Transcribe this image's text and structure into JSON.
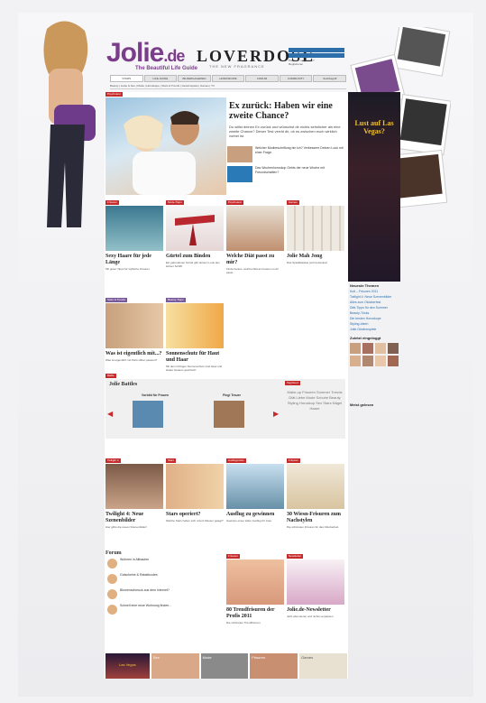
{
  "brand": {
    "name": "Jolie",
    "tld": ".de",
    "tagline": "The Beautiful Life Guide",
    "partner": "LOVERDOSE",
    "partner_sub": "THE NEW FRAGRANCE"
  },
  "header": {
    "login_labels": [
      "Passwort vergessen?",
      "Registrieren"
    ],
    "nav": [
      "STARS",
      "LIFE GUIDE",
      "BILDERGALERIEN",
      "HOROSKOPE",
      "FORUM",
      "COMMUNITY",
      "Suchbegriff"
    ],
    "subnav": "Beauty | Liebe & Sex | Mode | Horoskope | Stars & Trends | Gewinnspiele | Games | TV"
  },
  "hero": {
    "tag": "Psychotest",
    "title": "Ex zurück: Haben wir eine zweite Chance?",
    "text": "Du willst deinen Ex zurück und wünschst dir nichts sehnlicher als eine zweite Chance? Dieser Test verrät dir, ob es zwischen euch wirklich vorbei ist.",
    "subs": [
      {
        "text": "Welcher Modbeschriftung bin ich? Verbessere Deinen Look mit einer Frage."
      },
      {
        "text": "Das Wochenhoroskop Gehts der neue Woche mit Freundschaften?"
      }
    ]
  },
  "cards_row1": [
    {
      "tag": "Frisuren",
      "title": "Sexy Haare für jede Länge",
      "text": "Mit guten Tipps für stylische Frisuren."
    },
    {
      "tag": "Mode-Tipps",
      "title": "Gürtel zum Binden",
      "text": "Ein gebundener Gürtel gibt deinem Look den letzten Schliff."
    },
    {
      "tag": "Psychotest",
      "title": "Welche Diät passt zu mir?",
      "text": "Finde heraus, welche Diät am besten zu dir passt."
    },
    {
      "tag": "Games",
      "title": "Jolie Mah Jong",
      "text": "Das Spielklassiker jetzt kostenlos!"
    }
  ],
  "cards_row2": [
    {
      "tag": "Stars & Trends",
      "title": "Was ist eigentlich mit...?",
      "text": "Was ist eigentlich mit Paris Hilton passiert?"
    },
    {
      "tag": "Beauty-Tipps",
      "title": "Sonnenschutz für Haut und Haar",
      "text": "Mit dem richtigen Sonnenschutz sind Haut und Haare bestens geschützt."
    }
  ],
  "battles": {
    "tag": "Battle",
    "title": "Jolie Battles",
    "left": "Vorbild für Frauen",
    "right": "Fingi Trauer"
  },
  "tagcloud": {
    "tag": "TagCloud",
    "words": "Make-up Frisuren Sommer Trends Diät Liebe Mode Schuhe Beauty Styling Horoskop Sex Stars Nägel Haare"
  },
  "cards_row3": [
    {
      "tag": "Twilight 4",
      "title": "Twilight 4: Neue Szenenbilder",
      "text": "Hier gibts die neuen Szenenbilder!"
    },
    {
      "tag": "Stars",
      "title": "Stars operiert?",
      "text": "Welche Stars haben sich unters Messer gelegt?"
    },
    {
      "tag": "Ausflugsziele",
      "title": "Ausflug zu gewinnen",
      "text": "Gewinne einen tollen Ausflug für zwei."
    },
    {
      "tag": "Frisuren",
      "title": "30 Wiesn-Frisuren zum Nachstylen",
      "text": "Die schönsten Frisuren für das Oktoberfest."
    }
  ],
  "forum": {
    "title": "Forum",
    "rows": [
      {
        "text": "Wohnen in Altbauten"
      },
      {
        "text": "Gutscheine & Rabattcodes"
      },
      {
        "text": "Blumenschmuck aus dem Internet?"
      },
      {
        "text": "Schnell eine neue Wohnung finden..."
      }
    ]
  },
  "cards_row4": [
    {
      "tag": "Frisuren",
      "title": "80 Trendfrisuren der Profis 2011",
      "text": "Die schönsten Trendfrisuren."
    },
    {
      "tag": "Newsletter",
      "title": "Jolie.de-Newsletter",
      "text": "Jetzt abonnieren und nichts verpassen."
    }
  ],
  "sidebar": {
    "ad_title": "Lust auf Las Vegas?",
    "neueste_title": "Neueste Themen",
    "neueste": [
      "Kult – Frisuren 2011",
      "Twilight 4: Neue Szenenbilder",
      "Alles zum Oktoberfest",
      "Diät-Tipps für den Sommer",
      "Beauty-Tricks",
      "Die besten Horoskope",
      "Styling-Ideen",
      "Jolie-Gewinnspiele"
    ],
    "zuletzt_title": "Zuletzt eingeloggt",
    "more_title": "Meist gelesen"
  },
  "bottom_strip": [
    "Las Vegas",
    "Sex",
    "Mode",
    "Frisuren",
    "Games"
  ]
}
